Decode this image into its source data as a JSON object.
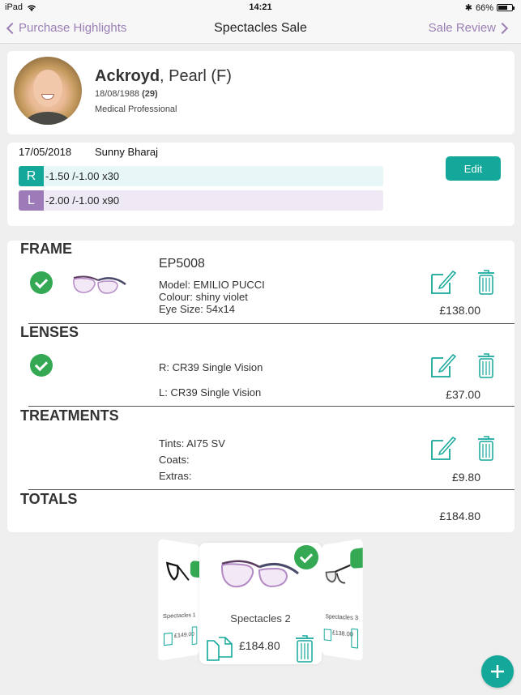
{
  "status_bar": {
    "device": "iPad",
    "time": "14:21",
    "battery": "66%",
    "battery_level": 0.66
  },
  "nav": {
    "back_label": "Purchase Highlights",
    "title": "Spectacles Sale",
    "forward_label": "Sale Review"
  },
  "patient": {
    "surname": "Ackroyd",
    "given": ", Pearl (F)",
    "dob": "18/08/1988",
    "age": "(29)",
    "occupation": "Medical Professional"
  },
  "prescription": {
    "date": "17/05/2018",
    "optometrist": "Sunny Bharaj",
    "right_label": "R",
    "right_value": "-1.50 /-1.00 x30",
    "left_label": "L",
    "left_value": "-2.00 /-1.00 x90",
    "edit_label": "Edit"
  },
  "sale": {
    "frame": {
      "title": "FRAME",
      "code": "EP5008",
      "model": "Model: EMILIO PUCCI",
      "colour": "Colour: shiny violet",
      "eye_size": "Eye Size: 54x14",
      "price": "£138.00"
    },
    "lenses": {
      "title": "LENSES",
      "right": "R: CR39 Single Vision",
      "left": "L: CR39 Single Vision",
      "price": "£37.00"
    },
    "treatments": {
      "title": "TREATMENTS",
      "tints": "Tints: AI75 SV",
      "coats": "Coats:",
      "extras": "Extras:",
      "price": "£9.80"
    },
    "totals": {
      "title": "TOTALS",
      "price": "£184.80"
    }
  },
  "carousel": {
    "items": [
      {
        "name": "Spectacles 1",
        "price": "£149.00"
      },
      {
        "name": "Spectacles 2",
        "price": "£184.80"
      },
      {
        "name": "Spectacles 3",
        "price": "£138.00"
      }
    ]
  },
  "colors": {
    "accent": "#14a89b",
    "nav_link": "#9b7fb5",
    "check": "#34a853"
  }
}
